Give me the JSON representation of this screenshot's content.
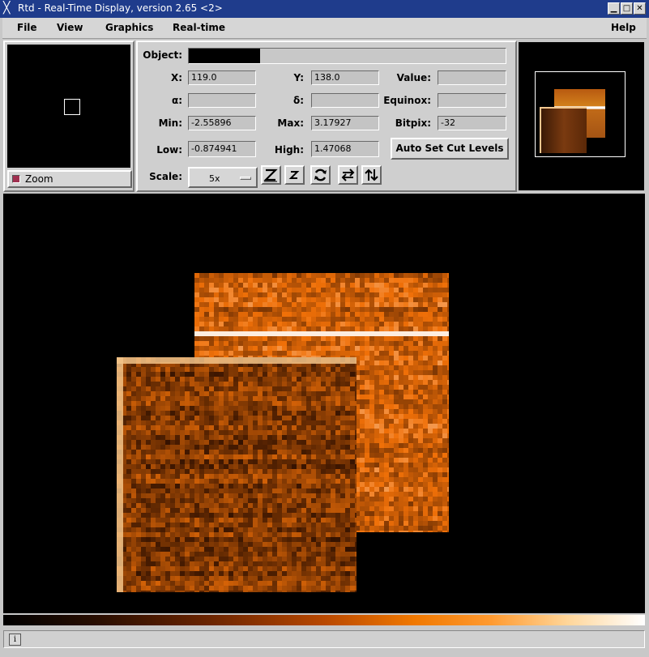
{
  "window": {
    "title": "Rtd - Real-Time Display, version 2.65 <2>",
    "controls": [
      "minimize",
      "maximize",
      "close"
    ]
  },
  "menubar": {
    "items": [
      {
        "label": "File",
        "key": "F"
      },
      {
        "label": "View",
        "key": "V"
      },
      {
        "label": "Graphics",
        "key": "G"
      },
      {
        "label": "Real-time",
        "key": "R"
      },
      {
        "label": "Help",
        "key": "H"
      }
    ]
  },
  "zoom_panel": {
    "toggle_label": "Zoom"
  },
  "info_panel": {
    "object_label": "Object:",
    "x_label": "X:",
    "x_value": "119.0",
    "y_label": "Y:",
    "y_value": "138.0",
    "value_label": "Value:",
    "value_value": "",
    "alpha_label": "α:",
    "alpha_value": "",
    "delta_label": "δ:",
    "delta_value": "",
    "equinox_label": "Equinox:",
    "equinox_value": "",
    "min_label": "Min:",
    "min_value": "-2.55896",
    "max_label": "Max:",
    "max_value": "3.17927",
    "bitpix_label": "Bitpix:",
    "bitpix_value": "-32",
    "low_label": "Low:",
    "low_value": "-0.874941",
    "high_label": "High:",
    "high_value": "1.47068",
    "auto_set_label": "Auto Set Cut Levels",
    "scale_label": "Scale:",
    "scale_value": "5x",
    "tool_icons": [
      "zoom-in-icon",
      "zoom-out-icon",
      "rotate-icon",
      "flip-x-icon",
      "flip-y-icon"
    ]
  },
  "colors": {
    "title_bar": "#1f3c8c",
    "image_low": "#000000",
    "image_mid": "#b84800",
    "image_high": "#ffffff"
  },
  "status_bar": {
    "icon": "info-icon",
    "text": ""
  }
}
